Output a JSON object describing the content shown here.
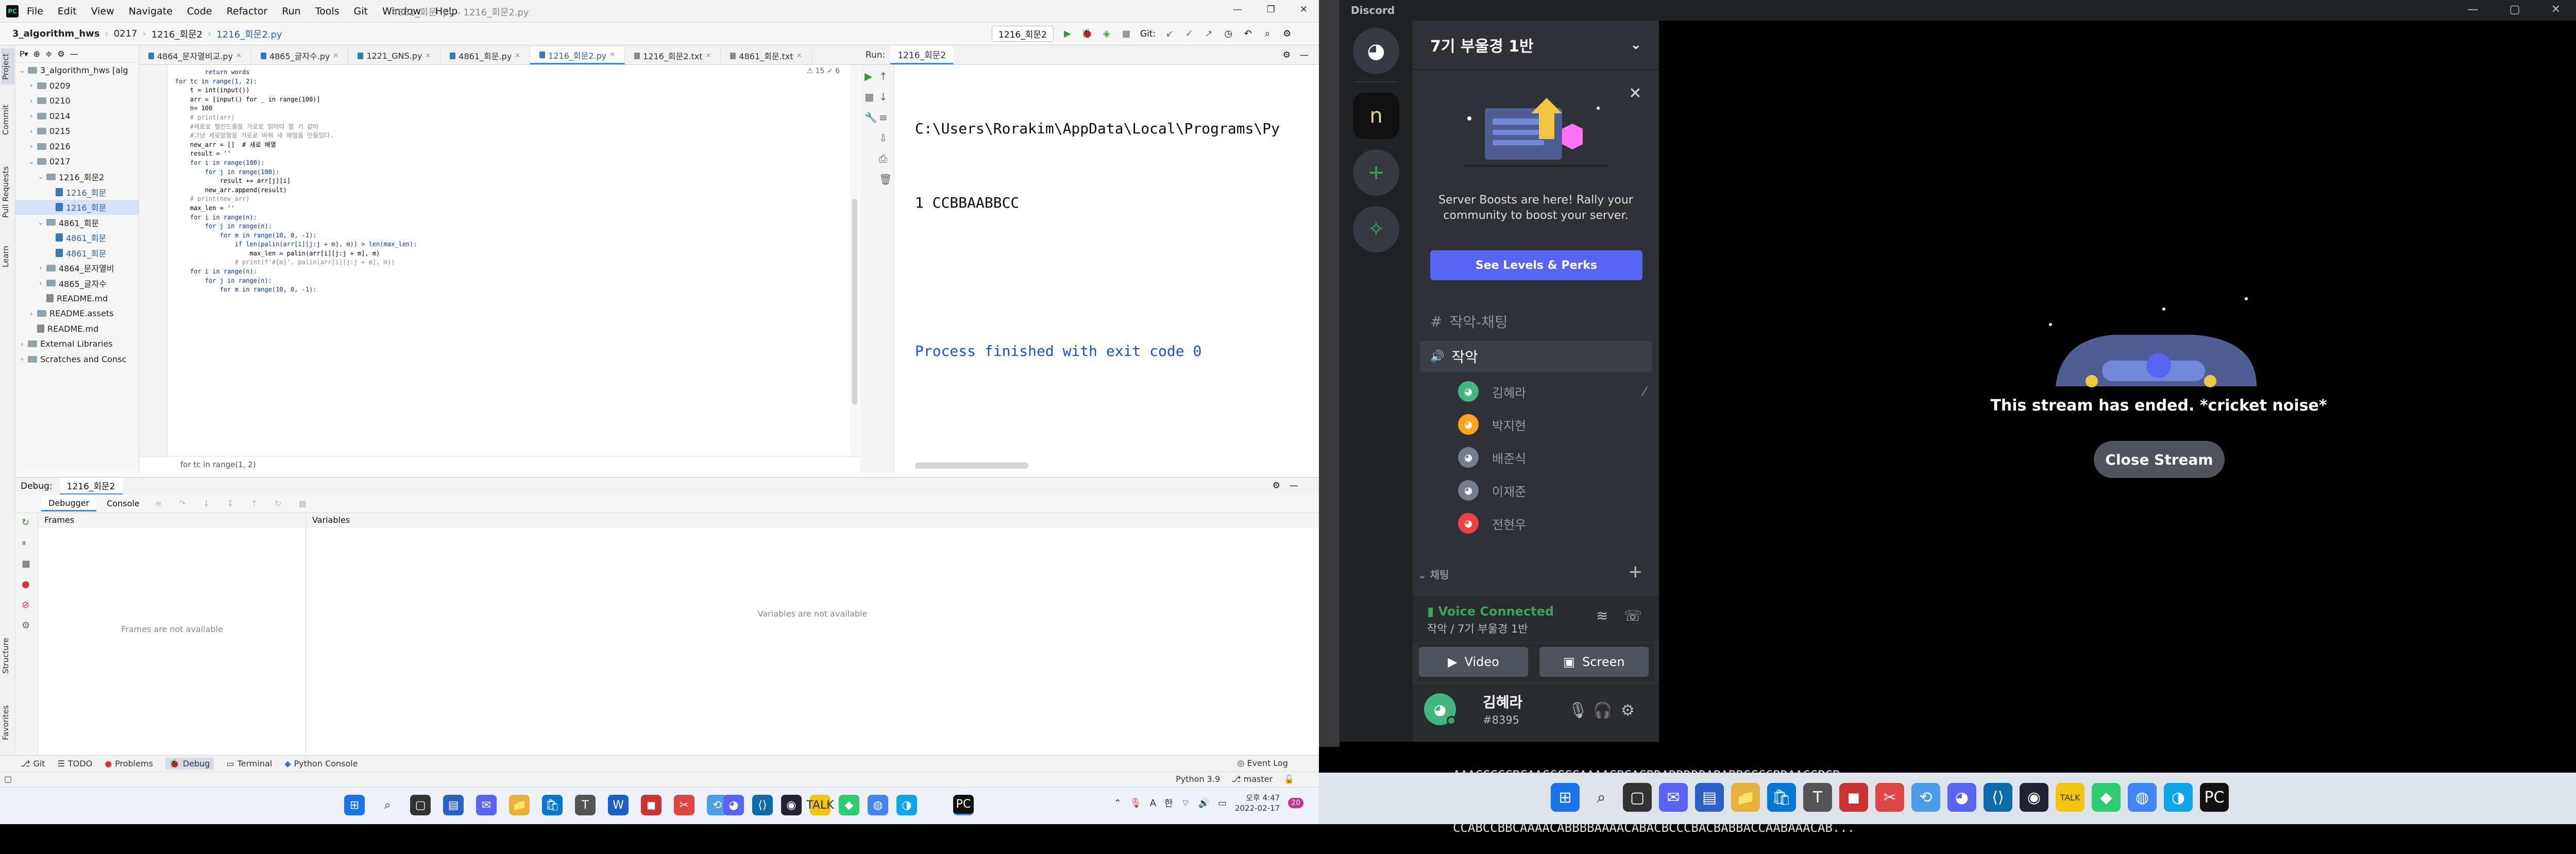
{
  "ide": {
    "window_title": "4861_회문 .py - 1216_회문2.py",
    "menu": [
      "File",
      "Edit",
      "View",
      "Navigate",
      "Code",
      "Refactor",
      "Run",
      "Tools",
      "Git",
      "Window",
      "Help"
    ],
    "nav_crumbs": [
      "3_algorithm_hws",
      "0217",
      "1216_회문2",
      "1216_회문2.py"
    ],
    "run_config": "1216_회문2",
    "git_label": "Git:",
    "project_tree": [
      {
        "label": "3_algorithm_hws [alg",
        "indent": 0,
        "type": "folder",
        "open": true
      },
      {
        "label": "0209",
        "indent": 1,
        "type": "folder"
      },
      {
        "label": "0210",
        "indent": 1,
        "type": "folder"
      },
      {
        "label": "0214",
        "indent": 1,
        "type": "folder"
      },
      {
        "label": "0215",
        "indent": 1,
        "type": "folder"
      },
      {
        "label": "0216",
        "indent": 1,
        "type": "folder"
      },
      {
        "label": "0217",
        "indent": 1,
        "type": "folder",
        "open": true
      },
      {
        "label": "1216_회문2",
        "indent": 2,
        "type": "folder",
        "open": true
      },
      {
        "label": "1216_회문",
        "indent": 3,
        "type": "py",
        "blue": true
      },
      {
        "label": "1216_회문",
        "indent": 3,
        "type": "py",
        "blue": true,
        "selected": true
      },
      {
        "label": "4861_회문",
        "indent": 2,
        "type": "folder",
        "open": true
      },
      {
        "label": "4861_회문",
        "indent": 3,
        "type": "py",
        "blue": true
      },
      {
        "label": "4861_회문",
        "indent": 3,
        "type": "py",
        "blue": true
      },
      {
        "label": "4864_문자열비",
        "indent": 2,
        "type": "folder"
      },
      {
        "label": "4865_글자수",
        "indent": 2,
        "type": "folder"
      },
      {
        "label": "README.md",
        "indent": 2,
        "type": "md"
      },
      {
        "label": "README.assets",
        "indent": 1,
        "type": "folder"
      },
      {
        "label": "README.md",
        "indent": 1,
        "type": "md"
      },
      {
        "label": "External Libraries",
        "indent": 0,
        "type": "folder"
      },
      {
        "label": "Scratches and Consc",
        "indent": 0,
        "type": "folder"
      }
    ],
    "editor_tabs": [
      {
        "label": "4864_문자열비교.py",
        "active": false
      },
      {
        "label": "4865_글자수.py",
        "active": false
      },
      {
        "label": "1221_GNS.py",
        "active": false
      },
      {
        "label": "4861_회문.py",
        "active": false
      },
      {
        "label": "1216_회문2.py",
        "active": true
      },
      {
        "label": "1216_회문2.txt",
        "active": false
      },
      {
        "label": "4861_회문.txt",
        "active": false
      }
    ],
    "inspection_counts": "⚠ 15  ✓ 6",
    "code_lines": [
      "        return words",
      "",
      "",
      "for tc in range(1, 2):",
      "    t = int(input())",
      "    arr = [input() for _ in range(100)]",
      "    n= 100",
      "    # print(arr)",
      "",
      "    #세로로 펠린드롬을 가로로 읽어야 할 거 같아",
      "    #그냥 세로방향을 가로로 바꿔 새 배열을 만들었다.",
      "    new_arr = []  # 새로 배열",
      "    result = ''",
      "    for i in range(100):",
      "        for j in range(100):",
      "            result += arr[j][i]",
      "        new_arr.append(result)",
      "",
      "    # print(new_arr)",
      "",
      "",
      "    max_len = ''",
      "    for i in range(n):",
      "        for j in range(n):",
      "            for m in range(10, 0, -1):",
      "                if len(palin(arr[i][j:j + m], m)) > len(max_len):",
      "                    max_len = palin(arr[i][j:j + m], m)",
      "                # print(f'#{m}', palin(arr[i][j:j + m], m))",
      "",
      "",
      "    for i in range(n):",
      "        for j in range(n):",
      "            for m in range(10, 0, -1):"
    ],
    "editor_breadcrumb": "for tc in range(1, 2)",
    "run": {
      "label": "Run:",
      "tab": "1216_회문2",
      "output_lines": [
        "C:\\Users\\Rorakim\\AppData\\Local\\Programs\\Py",
        "1 CCBBAABBCC",
        "",
        "Process finished with exit code 0"
      ]
    },
    "debug": {
      "label": "Debug:",
      "tab": "1216_회문2",
      "subtabs": [
        "Debugger",
        "Console"
      ],
      "frames_header": "Frames",
      "frames_empty": "Frames are not available",
      "vars_header": "Variables",
      "vars_empty": "Variables are not available"
    },
    "bottom_tabs": [
      "Git",
      "TODO",
      "Problems",
      "Debug",
      "Terminal",
      "Python Console"
    ],
    "event_log": "Event Log",
    "status_right": [
      "Python 3.9",
      "master"
    ],
    "left_stripe": [
      "Project",
      "Commit",
      "Pull Requests",
      "Learn"
    ],
    "left_stripe_bottom": [
      "Structure",
      "Favorites"
    ]
  },
  "taskbar_left": {
    "time": "오후 4:47",
    "date": "2022-02-17",
    "ime": "한",
    "ime2": "A",
    "badge": "20"
  },
  "discord": {
    "app_title": "Discord",
    "server_name": "7기 부울경 1반",
    "boost_text": "Server Boosts are here! Rally your community to boost your server.",
    "boost_button": "See Levels & Perks",
    "channels": [
      {
        "name": "작악-채팅",
        "type": "text",
        "selected": false
      },
      {
        "name": "작악",
        "type": "voice",
        "selected": true
      }
    ],
    "voice_users": [
      {
        "name": "김혜라",
        "color": "#43b581",
        "badge": "🎙"
      },
      {
        "name": "박지현",
        "color": "#faa61a"
      },
      {
        "name": "배준식",
        "color": "#747f8d"
      },
      {
        "name": "이재준",
        "color": "#747f8d"
      },
      {
        "name": "전현우",
        "color": "#ed4245"
      }
    ],
    "category_chat": "채팅",
    "voice_status": "Voice Connected",
    "voice_location": "작악 / 7기 부울경 1반",
    "video_button": "Video",
    "screen_button": "Screen",
    "user": {
      "name": "김혜라",
      "tag": "#8395"
    },
    "stream_message": "This stream has ended. *cricket noise*",
    "close_stream": "Close Stream",
    "colors": {
      "blurple": "#5865f2",
      "green": "#3ba55d",
      "bg": "#2f3136",
      "dark": "#202225"
    }
  },
  "background_text": [
    "AAACCCCCBCAACCCCCAAAACBCACBDADDDDDABABBCCCCBDAACCBCB...",
    "CCABCCBBCAAAACABBBBAAAACABACBCCCBACBABBACCAABAAACAB..."
  ]
}
